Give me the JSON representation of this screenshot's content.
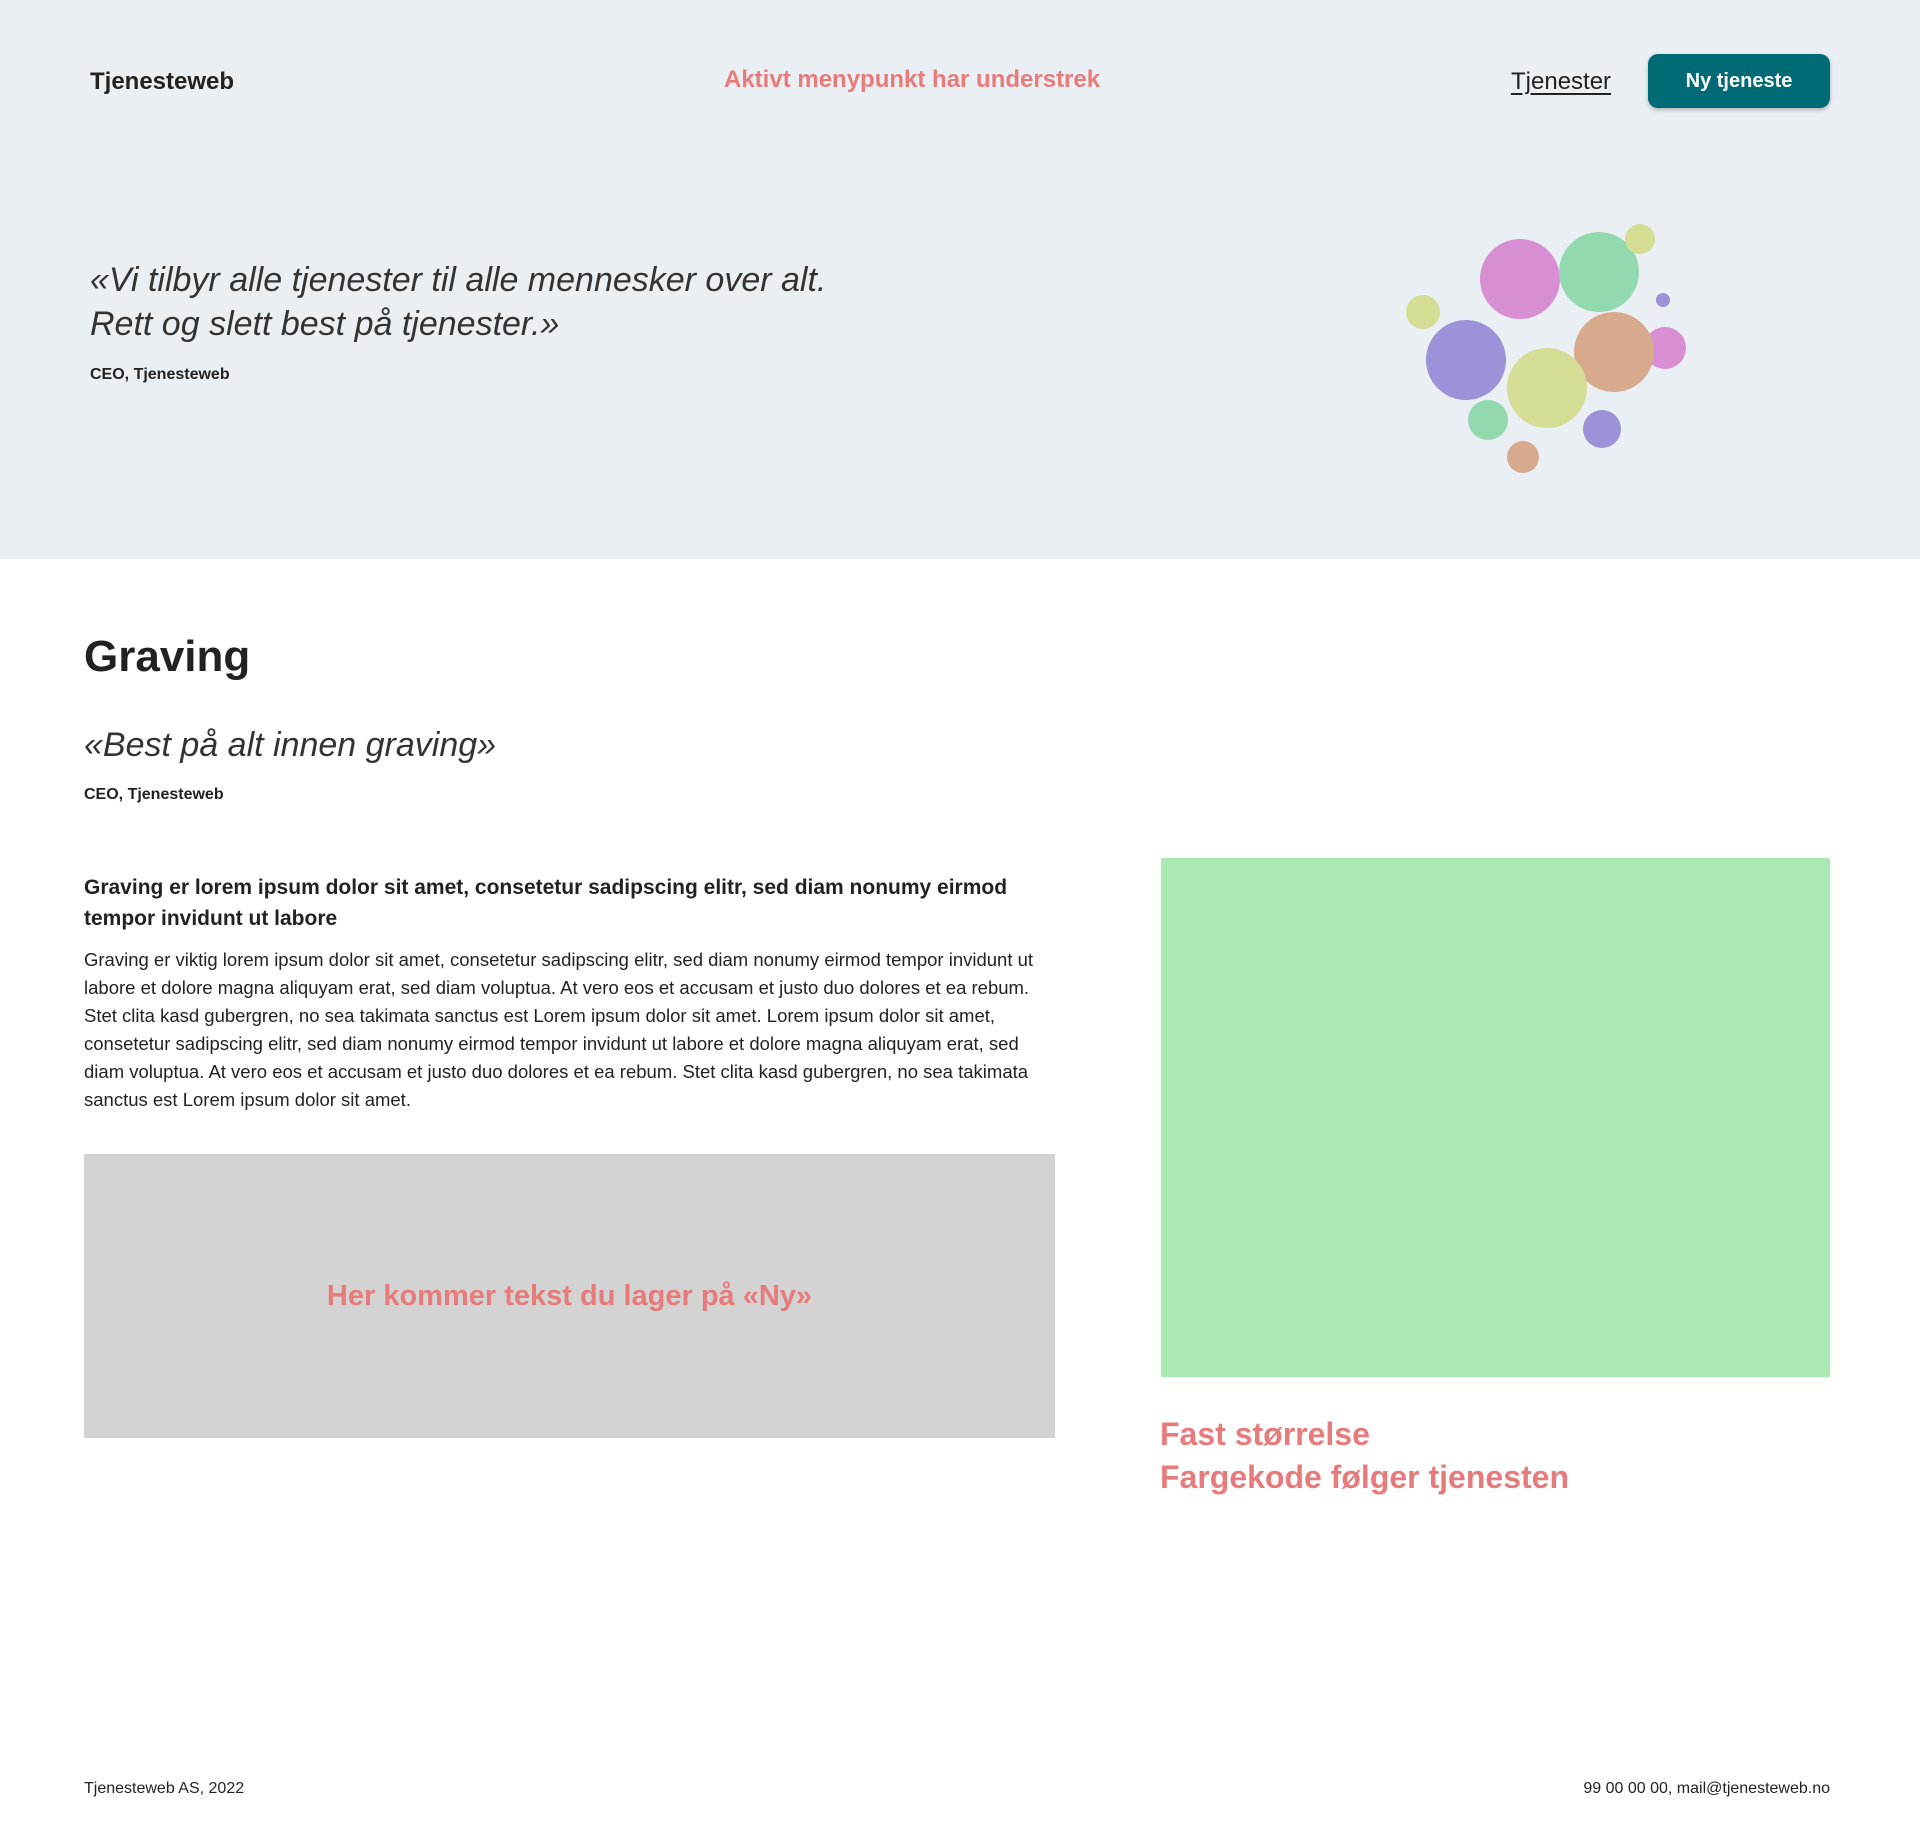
{
  "header": {
    "brand": "Tjenesteweb",
    "annotation": "Aktivt menypunkt har understrek",
    "nav_link": "Tjenester",
    "cta_label": "Ny tjeneste",
    "cta_color": "#006b75"
  },
  "hero": {
    "quote": "«Vi tilbyr alle tjenester til alle mennesker over alt. Rett og slett best på tjenester.»",
    "attribution": "CEO, Tjenesteweb",
    "illustration": "colored-bubbles",
    "bubble_colors": [
      "#d88ed3",
      "#93d9b0",
      "#9d91d8",
      "#d5dc93",
      "#d7aa8e"
    ]
  },
  "main": {
    "title": "Graving",
    "quote": "«Best på alt innen graving»",
    "attribution": "CEO, Tjenesteweb",
    "lead": "Graving er lorem ipsum dolor sit amet, consetetur sadipscing elitr, sed diam nonumy eirmod tempor invidunt ut labore",
    "body": "Graving er viktig lorem ipsum dolor sit amet, consetetur sadipscing elitr, sed diam nonumy eirmod tempor invidunt ut labore et dolore magna aliquyam erat, sed diam voluptua. At vero eos et accusam et justo duo dolores et ea rebum. Stet clita kasd gubergren, no sea takimata sanctus est Lorem ipsum dolor sit amet. Lorem ipsum dolor sit amet, consetetur sadipscing elitr, sed diam nonumy eirmod tempor invidunt ut labore et dolore magna aliquyam erat, sed diam voluptua. At vero eos et accusam et justo duo dolores et ea rebum. Stet clita kasd gubergren, no sea takimata sanctus est Lorem ipsum dolor sit amet.",
    "placeholder_text": "Her kommer tekst du lager på «Ny»",
    "image_color": "#a9e9b3",
    "notes": [
      "Fast størrelse",
      "Fargekode følger tjenesten"
    ]
  },
  "annotation_color": "#e77b7b",
  "footer": {
    "left": "Tjenesteweb AS, 2022",
    "right": "99 00 00 00, mail@tjenesteweb.no"
  }
}
